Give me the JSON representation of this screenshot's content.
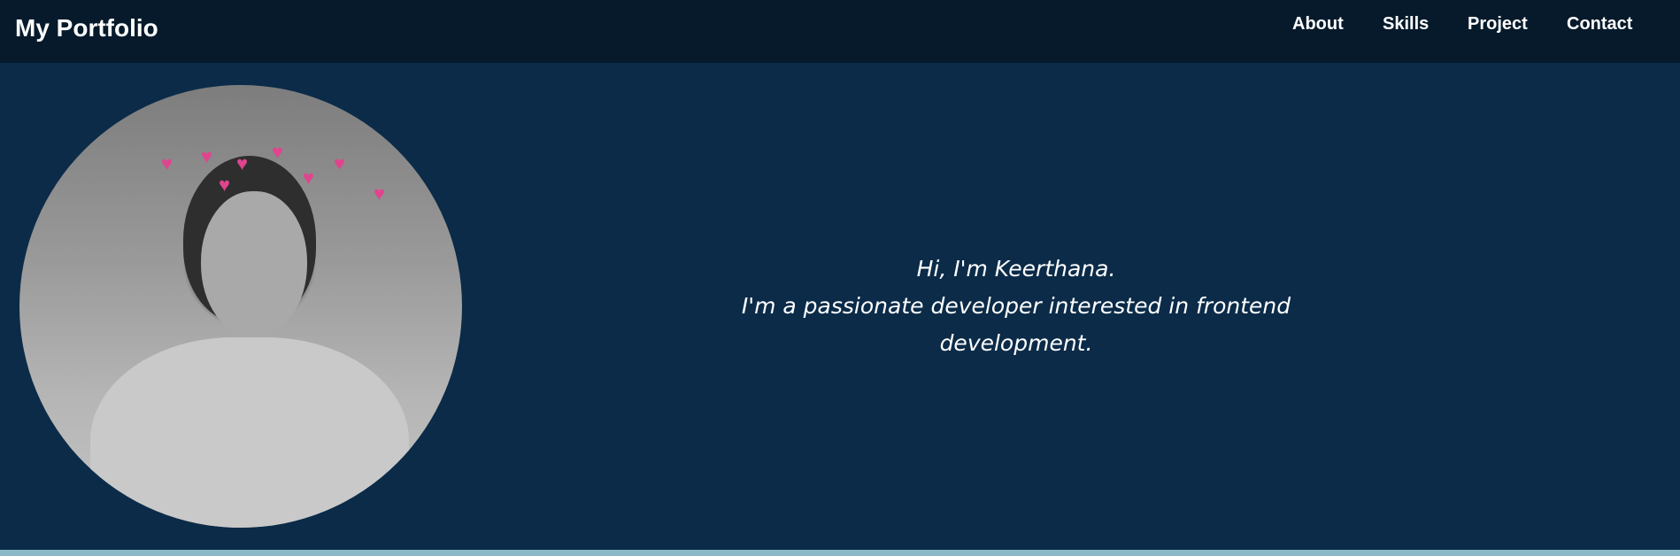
{
  "nav": {
    "brand": "My Portfolio",
    "links": [
      "About",
      "Skills",
      "Project",
      "Contact"
    ]
  },
  "hero": {
    "greeting": "Hi, I'm Keerthana.",
    "tagline": "I'm a passionate developer interested in frontend development."
  },
  "colors": {
    "navbar": "#061a2b",
    "background": "#0b2b48",
    "footer_strip": "#8ab8c6",
    "text": "#ffffff"
  }
}
